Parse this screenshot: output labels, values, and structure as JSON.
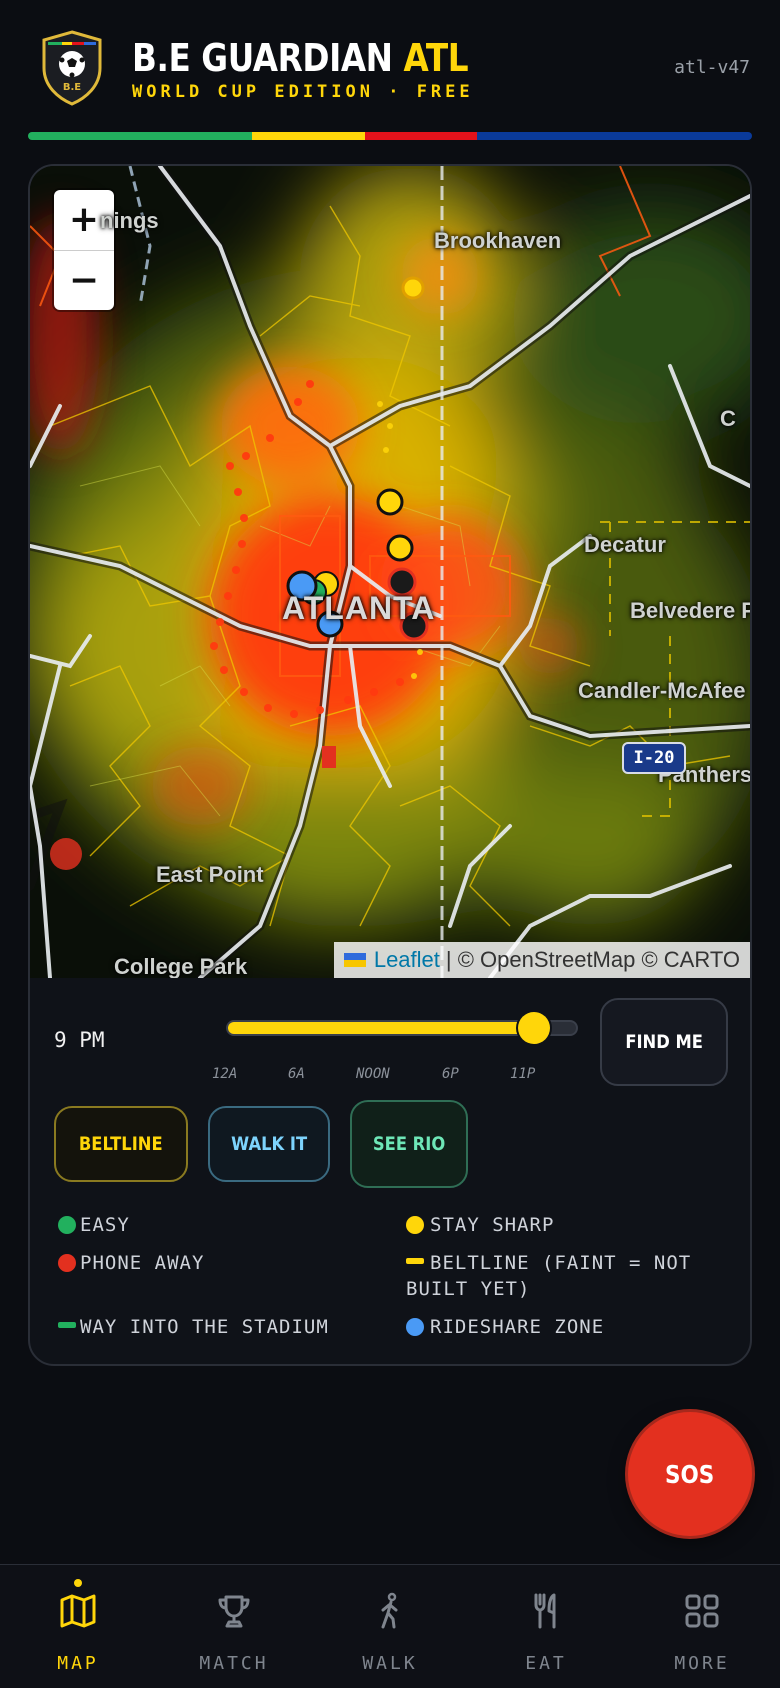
{
  "header": {
    "title_main": "B.E GUARDIAN",
    "title_accent": "ATL",
    "subtitle": "WORLD CUP EDITION · FREE",
    "version": "atl-v47",
    "logo_text": "B.E",
    "stripe_colors": [
      "#22b05e",
      "#ffd60a",
      "#e3121b",
      "#0a3a9a"
    ]
  },
  "map": {
    "zoom_in": "+",
    "zoom_out": "−",
    "labels": {
      "jennings": "nings",
      "brookhaven": "Brookhaven",
      "decatur": "Decatur",
      "belvedere": "Belvedere P",
      "candler": "Candler-McAfee",
      "panthersville": "Panthersvil",
      "atlanta": "ATLANTA",
      "east_point": "East Point",
      "college_park": "College Park",
      "edge_c": "C"
    },
    "highway_shield": "I-20",
    "attribution": {
      "leaflet": "Leaflet",
      "rest": "| © OpenStreetMap © CARTO"
    },
    "heat_colors": {
      "hot": "#ff2a1a",
      "warm": "#e0a800",
      "mild": "#8a8f10",
      "cool": "#2f5a18"
    }
  },
  "controls": {
    "time": "9 PM",
    "slider_value_fraction": 0.88,
    "ticks": [
      "12A",
      "6A",
      "NOON",
      "6P",
      "11P"
    ],
    "find_me": "FIND ME",
    "pills": [
      {
        "label": "BELTLINE",
        "color": "#ffd60a",
        "border": "#8a7a20"
      },
      {
        "label": "WALK IT",
        "color": "#7dd3fc",
        "border": "#3a6a80"
      },
      {
        "label": "SEE RIO",
        "color": "#6ee7b7",
        "border": "#2f6e55"
      }
    ]
  },
  "legend": [
    {
      "label": "EASY",
      "color": "#22b05e",
      "shape": "dot"
    },
    {
      "label": "STAY SHARP",
      "color": "#ffd60a",
      "shape": "dot"
    },
    {
      "label": "PHONE AWAY",
      "color": "#e3301f",
      "shape": "dot"
    },
    {
      "label": "BELTLINE (FAINT = NOT",
      "label2": "BUILT YET)",
      "color": "#ffd60a",
      "shape": "dash"
    },
    {
      "label": "WAY INTO THE STADIUM",
      "color": "#22b05e",
      "shape": "dash"
    },
    {
      "label": "RIDESHARE ZONE",
      "color": "#4a9af5",
      "shape": "dot"
    }
  ],
  "sos": "SOS",
  "nav": [
    {
      "label": "MAP",
      "icon": "map-icon",
      "active": true
    },
    {
      "label": "MATCH",
      "icon": "trophy-icon",
      "active": false
    },
    {
      "label": "WALK",
      "icon": "walking-person-icon",
      "active": false
    },
    {
      "label": "EAT",
      "icon": "fork-knife-icon",
      "active": false
    },
    {
      "label": "MORE",
      "icon": "grid-icon",
      "active": false
    }
  ]
}
